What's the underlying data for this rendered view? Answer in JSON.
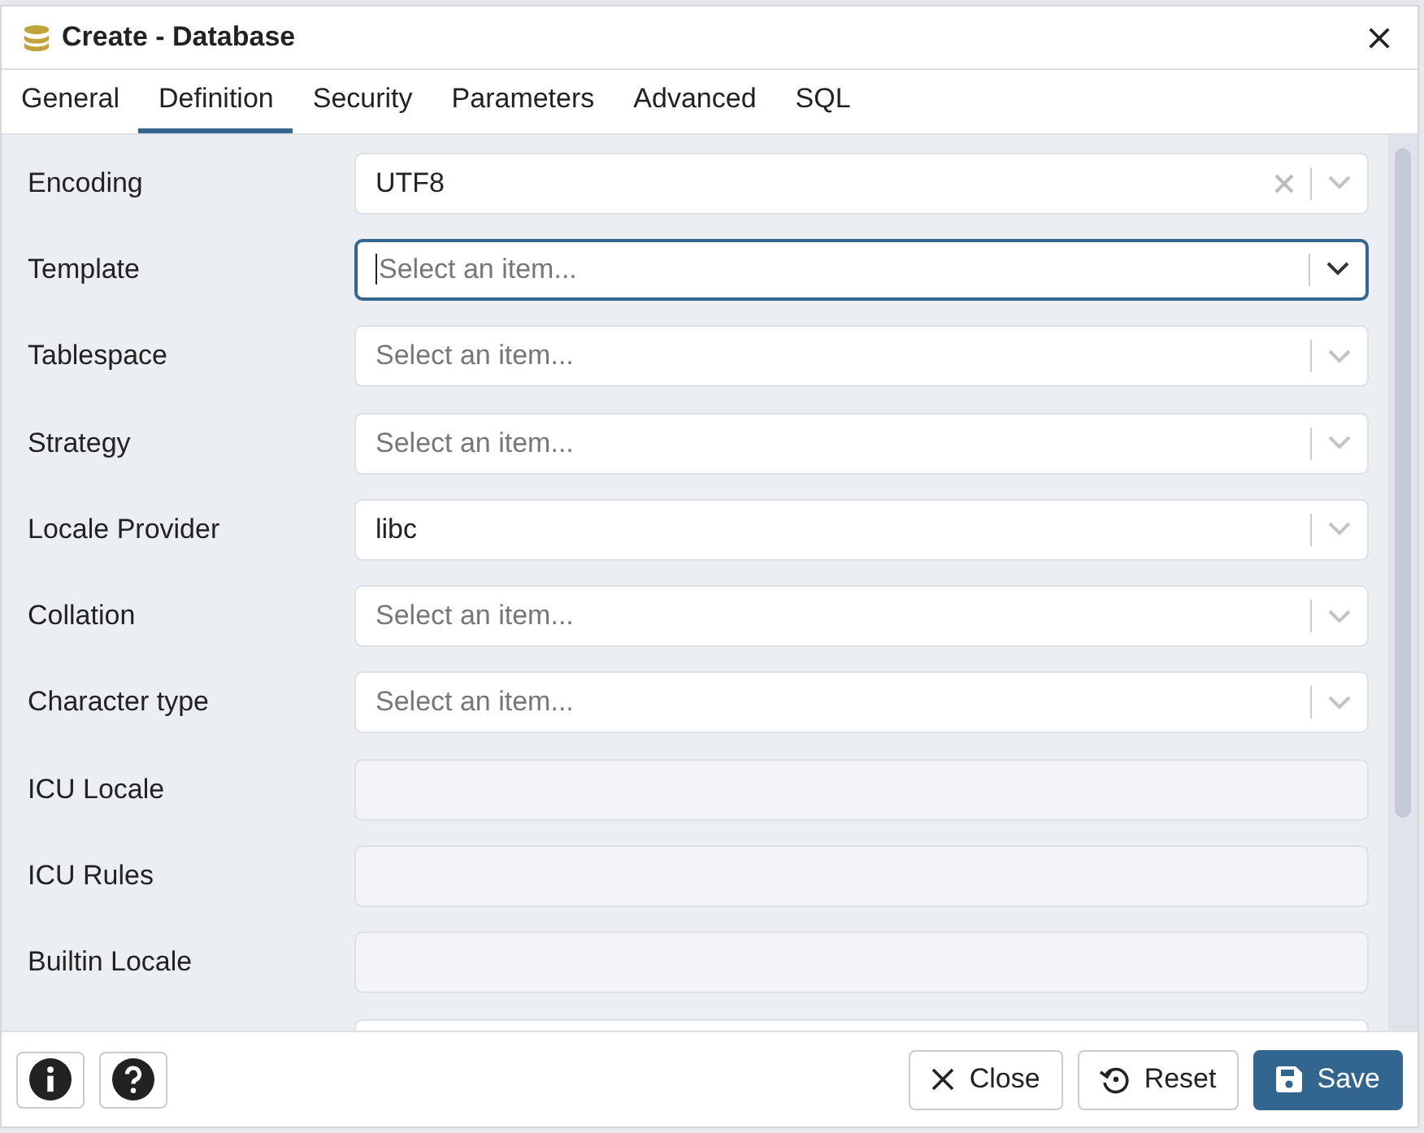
{
  "window": {
    "title": "Create - Database"
  },
  "tabs": [
    {
      "label": "General",
      "selected": false
    },
    {
      "label": "Definition",
      "selected": true
    },
    {
      "label": "Security",
      "selected": false
    },
    {
      "label": "Parameters",
      "selected": false
    },
    {
      "label": "Advanced",
      "selected": false
    },
    {
      "label": "SQL",
      "selected": false
    }
  ],
  "fields": [
    {
      "kind": "select",
      "label": "Encoding",
      "value": "UTF8",
      "clearable": true,
      "focused": false
    },
    {
      "kind": "select",
      "label": "Template",
      "placeholder": "Select an item...",
      "focused": true
    },
    {
      "kind": "select",
      "label": "Tablespace",
      "placeholder": "Select an item...",
      "focused": false
    },
    {
      "kind": "select",
      "label": "Strategy",
      "placeholder": "Select an item...",
      "focused": false
    },
    {
      "kind": "select",
      "label": "Locale Provider",
      "value": "libc",
      "focused": false
    },
    {
      "kind": "select",
      "label": "Collation",
      "placeholder": "Select an item...",
      "focused": false
    },
    {
      "kind": "select",
      "label": "Character type",
      "placeholder": "Select an item...",
      "focused": false
    },
    {
      "kind": "text",
      "label": "ICU Locale",
      "disabled": true
    },
    {
      "kind": "text",
      "label": "ICU Rules",
      "disabled": true
    },
    {
      "kind": "text",
      "label": "Builtin Locale",
      "disabled": true
    },
    {
      "kind": "text",
      "disabled": false
    }
  ],
  "footer": {
    "buttons": [
      {
        "kind": "close",
        "label": "Close"
      },
      {
        "kind": "reset",
        "label": "Reset"
      },
      {
        "kind": "save",
        "label": "Save"
      }
    ]
  }
}
